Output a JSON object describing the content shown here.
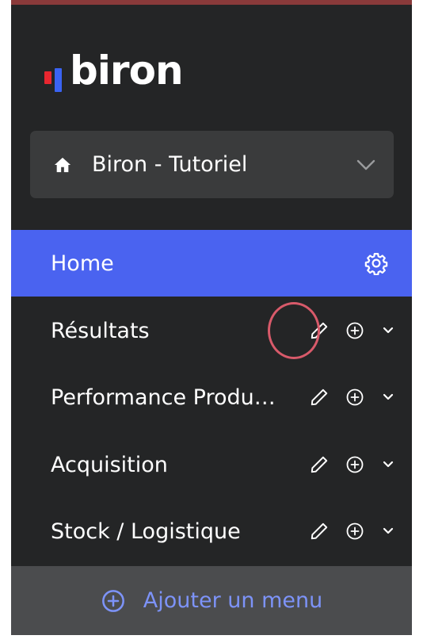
{
  "brand": {
    "name": "biron",
    "accent_red": "#e8262f",
    "accent_blue": "#3a63f2"
  },
  "workspace": {
    "name": "Biron - Tutoriel",
    "icon": "home-icon",
    "expand_icon": "chevron-down-icon"
  },
  "menu": {
    "items": [
      {
        "label": "Home",
        "active": true,
        "icons": [
          "gear-icon"
        ]
      },
      {
        "label": "Résultats",
        "active": false,
        "icons": [
          "pencil-icon",
          "plus-circle-icon",
          "chevron-down-icon"
        ]
      },
      {
        "label": "Performance Produits",
        "active": false,
        "icons": [
          "pencil-icon",
          "plus-circle-icon",
          "chevron-down-icon"
        ]
      },
      {
        "label": "Acquisition",
        "active": false,
        "icons": [
          "pencil-icon",
          "plus-circle-icon",
          "chevron-down-icon"
        ]
      },
      {
        "label": "Stock / Logistique",
        "active": false,
        "icons": [
          "pencil-icon",
          "plus-circle-icon",
          "chevron-down-icon"
        ]
      }
    ],
    "add_label": "Ajouter un menu",
    "add_icon": "plus-circle-icon"
  },
  "colors": {
    "sidebar_bg": "#242526",
    "active_bg": "#4a63f0",
    "add_menu_text": "#7d93f8",
    "highlight_ring": "#d85a6a"
  }
}
